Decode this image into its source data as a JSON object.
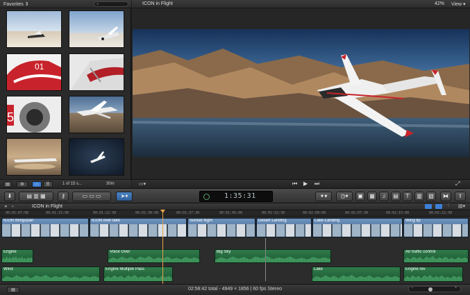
{
  "browser": {
    "collection": "Favorites",
    "selection_count": "1 of 15 s...",
    "duration": "30m"
  },
  "viewer": {
    "title": "ICON in Flight",
    "zoom": "42%",
    "view_menu": "View"
  },
  "toolbar": {
    "timecode": "1:35:31"
  },
  "timeline": {
    "project_name": "ICON in Flight",
    "ruler_ticks": [
      "00:01:07:00",
      "00:01:15:00",
      "00:01:22:30",
      "00:01:30:00",
      "00:01:37:30",
      "00:01:45:00",
      "00:01:52:30",
      "00:02:00:00",
      "00:02:07:30",
      "00:02:15:00",
      "00:02:22:30"
    ],
    "video_clips": [
      "ICON Wingspan",
      "ICON over lake",
      "Sunset flight",
      "Desert Landing",
      "Lake Landing",
      "Wing tip"
    ],
    "audio_clips_row1": [
      "Engine",
      "Voice Over",
      "Big Sky",
      "Air traffic control"
    ],
    "audio_clips_row2": [
      "Wind",
      "Engine Multiple Pass",
      "Lake",
      "Engine rev"
    ]
  },
  "status": {
    "summary": "02:58:42 total - 4949 × 1856 | 60 fps Stereo"
  },
  "colors": {
    "accent_blue": "#3d7fd6",
    "playhead": "#e8a34a",
    "video_clip": "#4f74a0",
    "audio_clip": "#2f7a4a"
  }
}
